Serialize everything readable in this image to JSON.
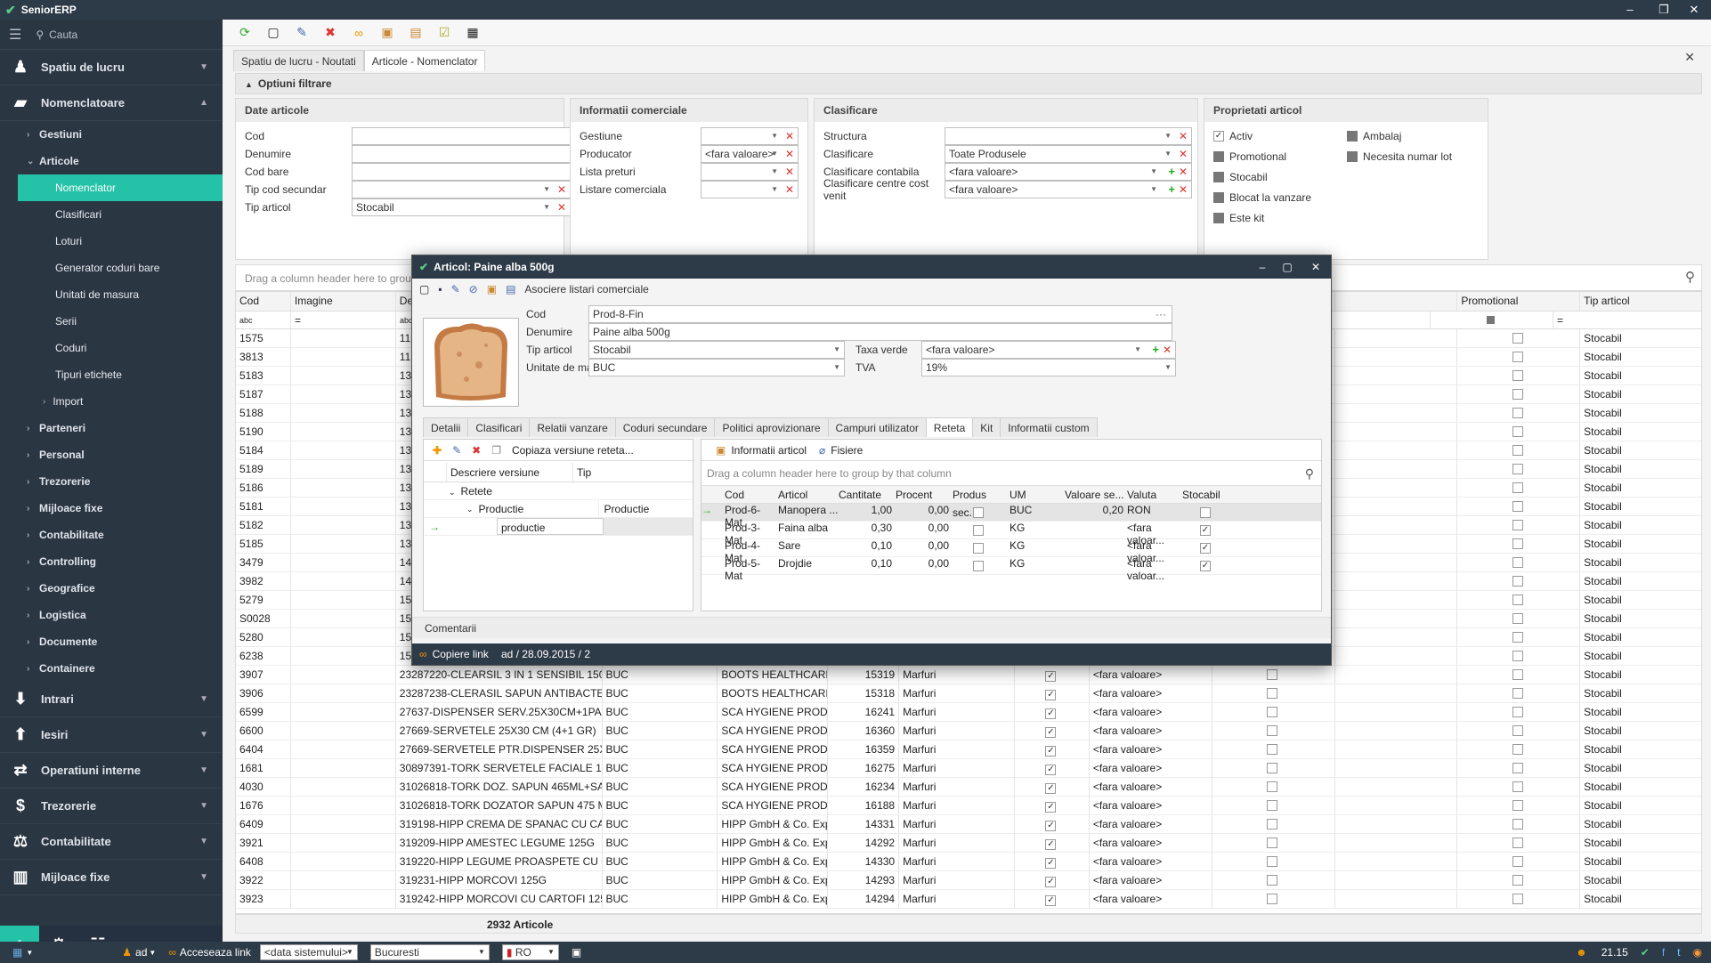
{
  "app": {
    "title": "SeniorERP"
  },
  "sidebar": {
    "search_placeholder": "Cauta",
    "sections": [
      {
        "label": "Spatiu de lucru",
        "icon": "user-icon"
      },
      {
        "label": "Nomenclatoare",
        "icon": "folder-icon"
      }
    ],
    "items": [
      "Gestiuni",
      "Articole"
    ],
    "subitems": [
      "Nomenclator",
      "Clasificari",
      "Loturi",
      "Generator coduri bare",
      "Unitati de masura",
      "Serii",
      "Coduri",
      "Tipuri etichete",
      "Import"
    ],
    "groups": [
      "Parteneri",
      "Personal",
      "Trezorerie",
      "Mijloace fixe",
      "Contabilitate",
      "Controlling",
      "Geografice",
      "Logistica",
      "Documente",
      "Containere"
    ],
    "bottom_sections": [
      {
        "label": "Intrari",
        "icon": "inbox-icon"
      },
      {
        "label": "Iesiri",
        "icon": "outbox-icon"
      },
      {
        "label": "Operatiuni interne",
        "icon": "transfer-icon"
      },
      {
        "label": "Trezorerie",
        "icon": "money-icon"
      },
      {
        "label": "Contabilitate",
        "icon": "scale-icon"
      },
      {
        "label": "Mijloace fixe",
        "icon": "building-icon"
      }
    ]
  },
  "tabs": [
    "Spatiu de lucru - Noutati",
    "Articole - Nomenclator"
  ],
  "filters": {
    "header": "Optiuni filtrare",
    "date_articole": {
      "title": "Date articole",
      "fields": [
        {
          "label": "Cod",
          "value": ""
        },
        {
          "label": "Denumire",
          "value": ""
        },
        {
          "label": "Cod bare",
          "value": ""
        },
        {
          "label": "Tip cod secundar",
          "value": ""
        },
        {
          "label": "Tip articol",
          "value": "Stocabil"
        }
      ]
    },
    "info_comerciale": {
      "title": "Informatii comerciale",
      "fields": [
        {
          "label": "Gestiune",
          "value": ""
        },
        {
          "label": "Producator",
          "value": "<fara valoare>"
        },
        {
          "label": "Lista preturi",
          "value": ""
        },
        {
          "label": "Listare comerciala",
          "value": ""
        }
      ]
    },
    "clasificare": {
      "title": "Clasificare",
      "fields": [
        {
          "label": "Structura",
          "value": ""
        },
        {
          "label": "Clasificare",
          "value": "Toate Produsele"
        },
        {
          "label": "Clasificare contabila",
          "value": "<fara valoare>"
        },
        {
          "label": "Clasificare centre cost venit",
          "value": "<fara valoare>"
        }
      ]
    },
    "proprietati": {
      "title": "Proprietati articol",
      "checks": [
        {
          "label": "Activ",
          "checked": true
        },
        {
          "label": "Ambalaj",
          "checked": false
        },
        {
          "label": "Promotional",
          "checked": false
        },
        {
          "label": "Necesita numar lot",
          "checked": false
        },
        {
          "label": "Stocabil",
          "checked": false
        },
        {
          "label": "Blocat la vanzare",
          "checked": false
        },
        {
          "label": "Este kit",
          "checked": false
        }
      ]
    }
  },
  "grid": {
    "group_hint": "Drag a column header here to group by that column",
    "headers": [
      "Cod",
      "Imagine",
      "Den",
      "",
      "",
      "",
      "",
      "",
      "",
      "",
      "",
      "",
      "",
      "Promotional",
      "Tip articol"
    ],
    "filter_abc": "abc",
    "filter_eq": "=",
    "rows_top": [
      {
        "cod": "1575",
        "den": "11",
        "tip": "Stocabil"
      },
      {
        "cod": "3813",
        "den": "11",
        "tip": "Stocabil"
      },
      {
        "cod": "5183",
        "den": "13",
        "tip": "Stocabil"
      },
      {
        "cod": "5187",
        "den": "13",
        "tip": "Stocabil"
      },
      {
        "cod": "5188",
        "den": "13",
        "tip": "Stocabil"
      },
      {
        "cod": "5190",
        "den": "13",
        "tip": "Stocabil"
      },
      {
        "cod": "5184",
        "den": "13",
        "tip": "Stocabil"
      },
      {
        "cod": "5189",
        "den": "13",
        "tip": "Stocabil"
      },
      {
        "cod": "5186",
        "den": "13",
        "tip": "Stocabil"
      },
      {
        "cod": "5181",
        "den": "13",
        "tip": "Stocabil"
      },
      {
        "cod": "5182",
        "den": "13",
        "tip": "Stocabil"
      },
      {
        "cod": "5185",
        "den": "13",
        "tip": "Stocabil"
      },
      {
        "cod": "3479",
        "den": "14",
        "tip": "Stocabil"
      },
      {
        "cod": "3982",
        "den": "14",
        "tip": "Stocabil"
      },
      {
        "cod": "5279",
        "den": "15",
        "tip": "Stocabil"
      },
      {
        "cod": "S0028",
        "den": "15",
        "tip": "Stocabil"
      },
      {
        "cod": "5280",
        "den": "15",
        "tip": "Stocabil"
      },
      {
        "cod": "6238",
        "den": "15",
        "tip": "Stocabil"
      }
    ],
    "rows": [
      {
        "cod": "3907",
        "den": "23287220-CLEARSIL 3 IN 1 SENSIBIL 150ML",
        "um": "BUC",
        "prod": "BOOTS HEALTHCARE",
        "nr": "15319",
        "tip2": "Marfuri",
        "val": "<fara valoare>",
        "tip": "Stocabil"
      },
      {
        "cod": "3906",
        "den": "23287238-CLERASIL SAPUN ANTIBACTER...",
        "um": "BUC",
        "prod": "BOOTS HEALTHCARE",
        "nr": "15318",
        "tip2": "Marfuri",
        "val": "<fara valoare>",
        "tip": "Stocabil"
      },
      {
        "cod": "6599",
        "den": "27637-DISPENSER SERV.25X30CM+1PAC...",
        "um": "BUC",
        "prod": "SCA HYGIENE PROD...",
        "nr": "16241",
        "tip2": "Marfuri",
        "val": "<fara valoare>",
        "tip": "Stocabil"
      },
      {
        "cod": "6600",
        "den": "27669-SERVETELE 25X30 CM (4+1 GR)",
        "um": "BUC",
        "prod": "SCA HYGIENE PROD...",
        "nr": "16360",
        "tip2": "Marfuri",
        "val": "<fara valoare>",
        "tip": "Stocabil"
      },
      {
        "cod": "6404",
        "den": "27669-SERVETELE PTR.DISPENSER 25X3...",
        "um": "BUC",
        "prod": "SCA HYGIENE PROD...",
        "nr": "16359",
        "tip2": "Marfuri",
        "val": "<fara valoare>",
        "tip": "Stocabil"
      },
      {
        "cod": "1681",
        "den": "30897391-TORK SERVETELE FACIALE 100...",
        "um": "BUC",
        "prod": "SCA HYGIENE PROD...",
        "nr": "16275",
        "tip2": "Marfuri",
        "val": "<fara valoare>",
        "tip": "Stocabil"
      },
      {
        "cod": "4030",
        "den": "31026818-TORK DOZ. SAPUN 465ML+SAP...",
        "um": "BUC",
        "prod": "SCA HYGIENE PROD...",
        "nr": "16234",
        "tip2": "Marfuri",
        "val": "<fara valoare>",
        "tip": "Stocabil"
      },
      {
        "cod": "1676",
        "den": "31026818-TORK DOZATOR SAPUN 475 ML",
        "um": "BUC",
        "prod": "SCA HYGIENE PROD...",
        "nr": "16188",
        "tip2": "Marfuri",
        "val": "<fara valoare>",
        "tip": "Stocabil"
      },
      {
        "cod": "6409",
        "den": "319198-HIPP CREMA DE SPANAC CU CAR...",
        "um": "BUC",
        "prod": "HIPP GmbH & Co. Exp...",
        "nr": "14331",
        "tip2": "Marfuri",
        "val": "<fara valoare>",
        "tip": "Stocabil"
      },
      {
        "cod": "3921",
        "den": "319209-HIPP AMESTEC LEGUME 125G",
        "um": "BUC",
        "prod": "HIPP GmbH & Co. Exp...",
        "nr": "14292",
        "tip2": "Marfuri",
        "val": "<fara valoare>",
        "tip": "Stocabil"
      },
      {
        "cod": "6408",
        "den": "319220-HIPP LEGUME PROASPETE CU O...",
        "um": "BUC",
        "prod": "HIPP GmbH & Co. Exp...",
        "nr": "14330",
        "tip2": "Marfuri",
        "val": "<fara valoare>",
        "tip": "Stocabil"
      },
      {
        "cod": "3922",
        "den": "319231-HIPP MORCOVI 125G",
        "um": "BUC",
        "prod": "HIPP GmbH & Co. Exp...",
        "nr": "14293",
        "tip2": "Marfuri",
        "val": "<fara valoare>",
        "tip": "Stocabil"
      },
      {
        "cod": "3923",
        "den": "319242-HIPP MORCOVI CU CARTOFI 125G",
        "um": "BUC",
        "prod": "HIPP GmbH & Co. Exp...",
        "nr": "14294",
        "tip2": "Marfuri",
        "val": "<fara valoare>",
        "tip": "Stocabil"
      }
    ],
    "count": "2932 Articole"
  },
  "dialog": {
    "title": "Articol: Paine alba 500g",
    "toolbar_label": "Asociere listari comerciale",
    "cod_label": "Cod",
    "cod": "Prod-8-Fin",
    "den_label": "Denumire",
    "den": "Paine alba 500g",
    "tip_label": "Tip articol",
    "tip": "Stocabil",
    "um_label": "Unitate de masura",
    "um": "BUC",
    "taxa_label": "Taxa verde",
    "taxa": "<fara valoare>",
    "tva_label": "TVA",
    "tva": "19%",
    "tabs": [
      "Detalii",
      "Clasificari",
      "Relatii vanzare",
      "Coduri secundare",
      "Politici aprovizionare",
      "Campuri utilizator",
      "Reteta",
      "Kit",
      "Informatii custom"
    ],
    "left_tb": "Copiaza versiune reteta...",
    "left_headers": [
      "Descriere versiune",
      "Tip"
    ],
    "tree": [
      "Retete",
      "Productie",
      "Productie",
      "productie"
    ],
    "right_tb": [
      "Informatii articol",
      "Fisiere"
    ],
    "group_hint": "Drag a column header here to group by that column",
    "headers": [
      "Cod",
      "Articol",
      "Cantitate",
      "Procent",
      "Produs sec...",
      "UM",
      "Valoare se...",
      "Valuta",
      "Stocabil"
    ],
    "rows": [
      {
        "cod": "Prod-6-Mat",
        "art": "Manopera ...",
        "cant": "1,00",
        "proc": "0,00",
        "um": "BUC",
        "val": "0,20",
        "valuta": "RON",
        "stoc": false
      },
      {
        "cod": "Prod-3-Mat",
        "art": "Faina alba",
        "cant": "0,30",
        "proc": "0,00",
        "um": "KG",
        "val": "",
        "valuta": "<fara valoar...",
        "stoc": true
      },
      {
        "cod": "Prod-4-Mat",
        "art": "Sare",
        "cant": "0,10",
        "proc": "0,00",
        "um": "KG",
        "val": "",
        "valuta": "<fara valoar...",
        "stoc": true
      },
      {
        "cod": "Prod-5-Mat",
        "art": "Drojdie",
        "cant": "0,10",
        "proc": "0,00",
        "um": "KG",
        "val": "",
        "valuta": "<fara valoar...",
        "stoc": true
      }
    ],
    "comments": "Comentarii",
    "status_link": "Copiere link",
    "status_info": "ad / 28.09.2015 / 2"
  },
  "status": {
    "user": "ad",
    "link": "Acceseaza link",
    "date": "<data sistemului>",
    "city": "Bucuresti",
    "lang": "RO",
    "time": "21.15"
  }
}
